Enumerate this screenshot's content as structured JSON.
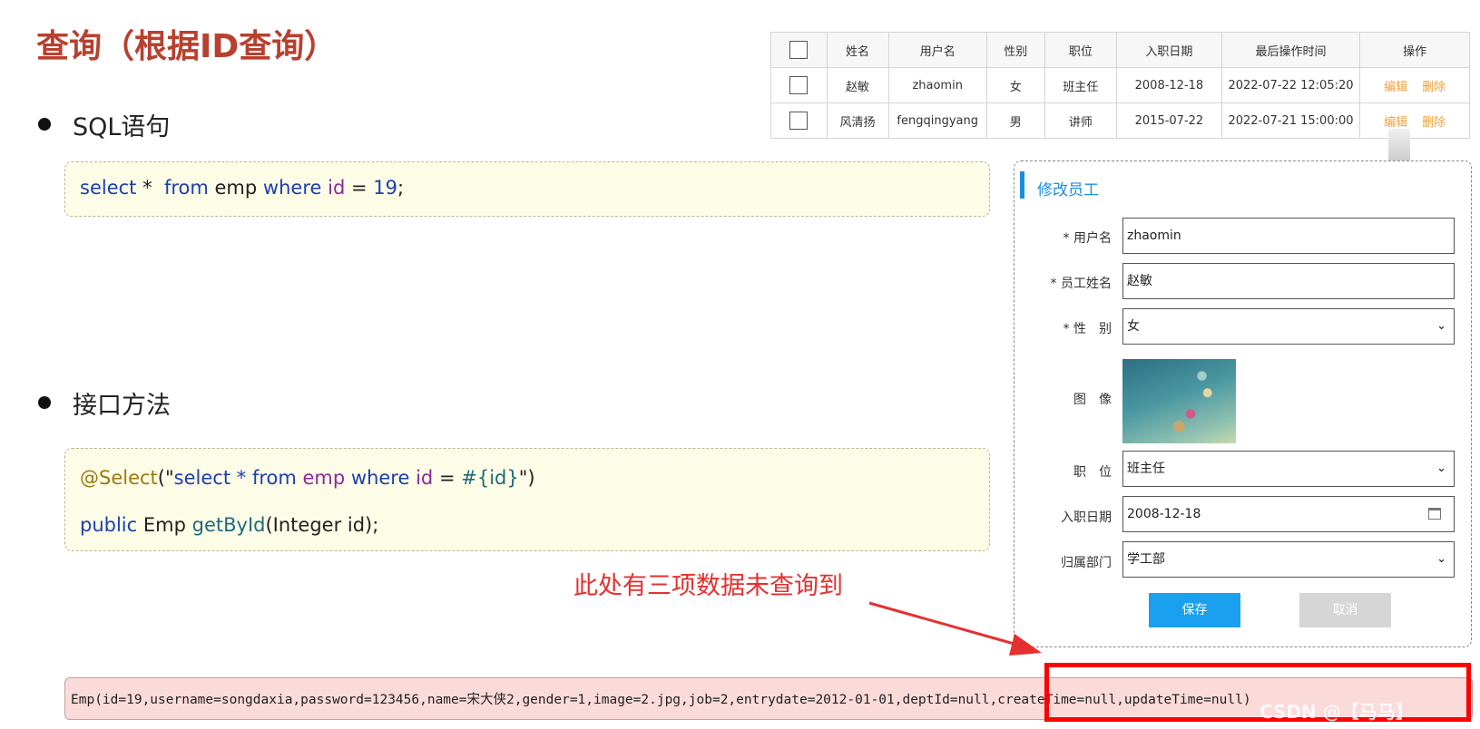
{
  "slide": {
    "title": "查询（根据ID查询）",
    "bullet_sql": "SQL语句",
    "bullet_api": "接口方法"
  },
  "sql_code": {
    "select": "select",
    "star": "*",
    "from": "from",
    "table": "emp",
    "where": "where",
    "field": "id",
    "eq": "=",
    "value": "19",
    "end": ";"
  },
  "api_code": {
    "annotation": "@Select",
    "open": "(\"",
    "select": "select",
    "star": "*",
    "from": "from",
    "table": "emp",
    "where": "where",
    "field": "id",
    "eq": "=",
    "param": "#{id}",
    "close": "\")",
    "public": "public",
    "type": "Emp",
    "method": "getById",
    "args": "(Integer id);"
  },
  "table": {
    "headers": [
      "姓名",
      "用户名",
      "性别",
      "职位",
      "入职日期",
      "最后操作时间",
      "操作"
    ],
    "rows": [
      {
        "name": "赵敏",
        "username": "zhaomin",
        "gender": "女",
        "job": "班主任",
        "entry": "2008-12-18",
        "updated": "2022-07-22 12:05:20",
        "edit": "编辑",
        "delete": "删除"
      },
      {
        "name": "风清扬",
        "username": "fengqingyang",
        "gender": "男",
        "job": "讲师",
        "entry": "2015-07-22",
        "updated": "2022-07-21 15:00:00",
        "edit": "编辑",
        "delete": "删除"
      }
    ]
  },
  "dialog": {
    "title": "修改员工",
    "username_label": "* 用户名",
    "username_value": "zhaomin",
    "name_label": "* 员工姓名",
    "name_value": "赵敏",
    "gender_label": "* 性　别",
    "gender_value": "女",
    "image_label": "图　像",
    "job_label": "职　位",
    "job_value": "班主任",
    "entry_label": "入职日期",
    "entry_value": "2008-12-18",
    "dept_label": "归属部门",
    "dept_value": "学工部",
    "save": "保存",
    "cancel": "取消"
  },
  "annotation": "此处有三项数据未查询到",
  "output": "Emp(id=19,username=songdaxia,password=123456,name=宋大侠2,gender=1,image=2.jpg,job=2,entrydate=2012-01-01,deptId=null,createTime=null,updateTime=null)",
  "watermark": "CSDN @【马马】",
  "colors": {
    "accent": "#1a8ee0",
    "title": "#b8402e",
    "annotation": "#e53030",
    "highlight": "#ff0000"
  }
}
